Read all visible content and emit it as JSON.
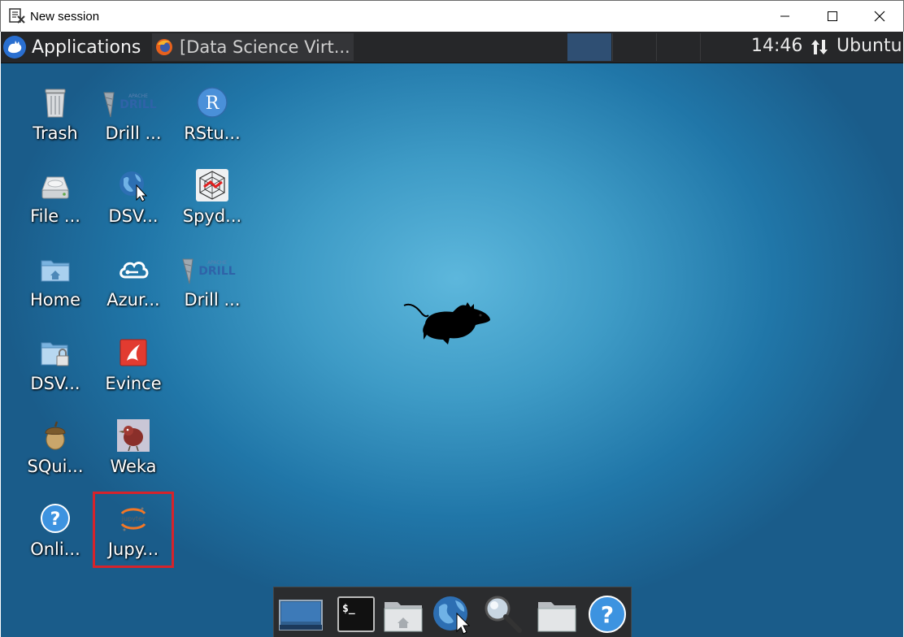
{
  "window": {
    "title": "New session",
    "controls": {
      "minimize": "minimize-icon",
      "maximize": "maximize-icon",
      "close": "close-icon"
    }
  },
  "panel": {
    "applications_label": "Applications",
    "task_label": "[Data Science Virt...",
    "clock": "14:46",
    "user": "Ubuntu"
  },
  "desktop": {
    "icons": [
      {
        "label": "Trash",
        "icon": "trash-icon"
      },
      {
        "label": "Drill ...",
        "icon": "apache-drill-icon"
      },
      {
        "label": "RStu...",
        "icon": "rstudio-icon"
      },
      {
        "label": "File ...",
        "icon": "file-system-icon"
      },
      {
        "label": "DSV...",
        "icon": "web-browser-icon"
      },
      {
        "label": "Spyd...",
        "icon": "spyder-icon"
      },
      {
        "label": "Home",
        "icon": "home-folder-icon"
      },
      {
        "label": "Azur...",
        "icon": "azure-cloud-icon"
      },
      {
        "label": "Drill ...",
        "icon": "apache-drill-icon"
      },
      {
        "label": "DSV...",
        "icon": "locked-folder-icon"
      },
      {
        "label": "Evince",
        "icon": "evince-icon"
      },
      {
        "label": "SQui...",
        "icon": "squirrel-acorn-icon"
      },
      {
        "label": "Weka",
        "icon": "weka-bird-icon"
      },
      {
        "label": "Onli...",
        "icon": "help-icon"
      },
      {
        "label": "Jupy...",
        "icon": "jupyter-icon"
      }
    ],
    "highlight_color": "#d6232b"
  },
  "dock": {
    "items": [
      "show-desktop-icon",
      "terminal-icon",
      "home-folder-icon",
      "web-browser-icon",
      "search-icon",
      "folder-icon",
      "help-icon"
    ]
  },
  "colors": {
    "panel_bg": "#262729",
    "workspace_active": "#2f4f73",
    "desktop_center": "#5db7dc",
    "desktop_edge": "#1a5c8a"
  }
}
